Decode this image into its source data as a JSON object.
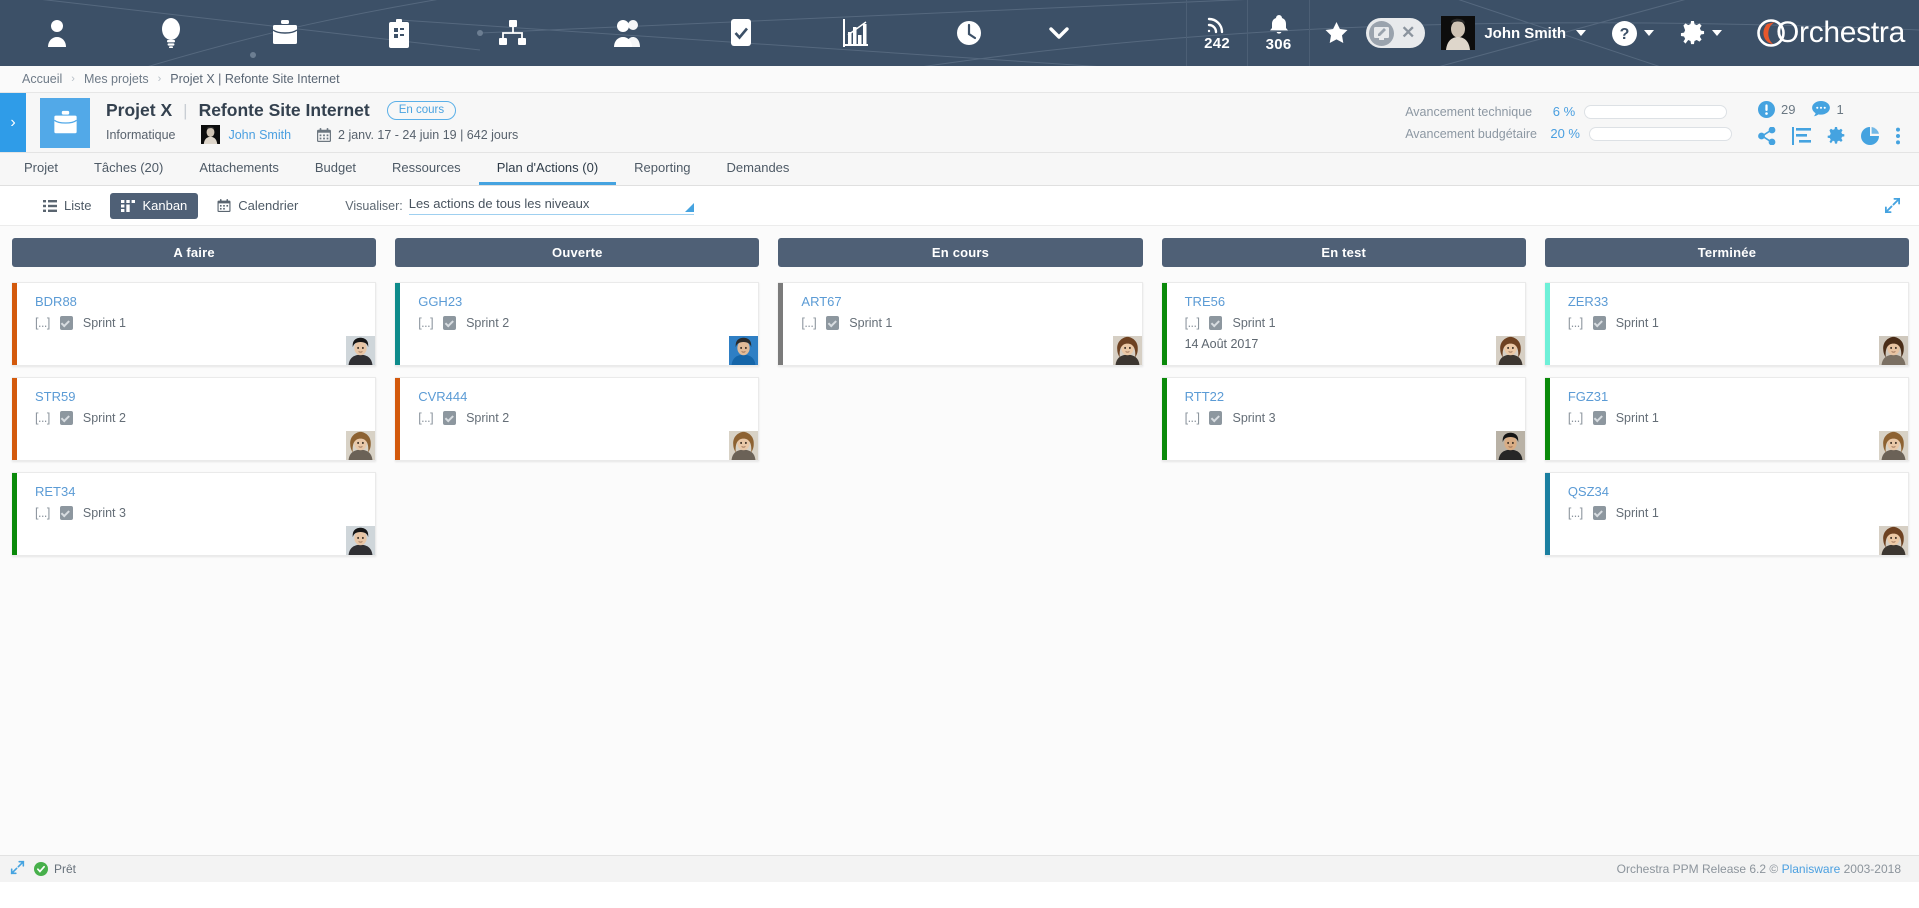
{
  "topnav": {
    "icons": [
      {
        "name": "person-icon",
        "title": "Utilisateur"
      },
      {
        "name": "lightbulb-icon",
        "title": "Idées"
      },
      {
        "name": "briefcase-icon",
        "title": "Portefeuille"
      },
      {
        "name": "clipboard-icon",
        "title": "Projets"
      },
      {
        "name": "org-chart-icon",
        "title": "Organisation"
      },
      {
        "name": "users-icon",
        "title": "Ressources"
      },
      {
        "name": "checkbox-icon",
        "title": "Tâches"
      },
      {
        "name": "bar-chart-icon",
        "title": "Reporting"
      },
      {
        "name": "clock-icon",
        "title": "Temps"
      }
    ],
    "more_label": "chevron-down-icon",
    "feed_count": "242",
    "alert_count": "306",
    "user_name": "John Smith",
    "brand": "Orchestra"
  },
  "breadcrumb": {
    "items": [
      "Accueil",
      "Mes projets",
      "Projet X | Refonte Site Internet"
    ],
    "separator": "›"
  },
  "project": {
    "name": "Projet X",
    "divider": "|",
    "subtitle": "Refonte Site Internet",
    "status": "En cours",
    "category": "Informatique",
    "owner": "John Smith",
    "dates": "2 janv. 17 - 24 juin 19 | 642 jours",
    "progress": [
      {
        "label": "Avancement technique",
        "value": "6 %",
        "percent": 6
      },
      {
        "label": "Avancement budgétaire",
        "value": "20 %",
        "percent": 20
      }
    ],
    "stats": [
      {
        "name": "alert-count",
        "icon": "exclamation-icon",
        "value": "29"
      },
      {
        "name": "comment-count",
        "icon": "comment-icon",
        "value": "1"
      }
    ],
    "actions": [
      "share-icon",
      "outline-icon",
      "gear-icon",
      "pie-chart-icon",
      "more-vertical-icon"
    ]
  },
  "tabs": [
    {
      "label": "Projet",
      "active": false
    },
    {
      "label": "Tâches (20)",
      "active": false
    },
    {
      "label": "Attachements",
      "active": false
    },
    {
      "label": "Budget",
      "active": false
    },
    {
      "label": "Ressources",
      "active": false
    },
    {
      "label": "Plan d'Actions (0)",
      "active": true
    },
    {
      "label": "Reporting",
      "active": false
    },
    {
      "label": "Demandes",
      "active": false
    }
  ],
  "toolbar": {
    "views": [
      {
        "label": "Liste",
        "icon": "list-icon",
        "active": false
      },
      {
        "label": "Kanban",
        "icon": "kanban-icon",
        "active": true
      },
      {
        "label": "Calendrier",
        "icon": "calendar-icon",
        "active": false
      }
    ],
    "visualize_label": "Visualiser:",
    "visualize_value": "Les actions de tous les niveaux",
    "expand_icon": "expand-icon"
  },
  "board": {
    "columns": [
      {
        "title": "A faire",
        "cards": [
          {
            "code": "BDR88",
            "dots": "[...]",
            "sprint": "Sprint 1",
            "date": "",
            "accent": "#d3590c",
            "avatar": "asian-man"
          },
          {
            "code": "STR59",
            "dots": "[...]",
            "sprint": "Sprint 2",
            "date": "",
            "accent": "#d3590c",
            "avatar": "blonde-woman"
          },
          {
            "code": "RET34",
            "dots": "[...]",
            "sprint": "Sprint 3",
            "date": "",
            "accent": "#0a8a0a",
            "avatar": "asian-man"
          }
        ]
      },
      {
        "title": "Ouverte",
        "cards": [
          {
            "code": "GGH23",
            "dots": "[...]",
            "sprint": "Sprint 2",
            "date": "",
            "accent": "#0e8b8b",
            "avatar": "blue-shirt-man"
          },
          {
            "code": "CVR444",
            "dots": "[...]",
            "sprint": "Sprint 2",
            "date": "",
            "accent": "#d3590c",
            "avatar": "blonde-woman"
          }
        ]
      },
      {
        "title": "En cours",
        "cards": [
          {
            "code": "ART67",
            "dots": "[...]",
            "sprint": "Sprint 1",
            "date": "",
            "accent": "#7b7b7b",
            "avatar": "brown-hair-woman"
          }
        ]
      },
      {
        "title": "En test",
        "cards": [
          {
            "code": "TRE56",
            "dots": "[...]",
            "sprint": "Sprint 1",
            "date": "14 Août 2017",
            "accent": "#0a8a0a",
            "avatar": "brown-hair-woman"
          },
          {
            "code": "RTT22",
            "dots": "[...]",
            "sprint": "Sprint 3",
            "date": "",
            "accent": "#0a8a0a",
            "avatar": "dark-hair-man"
          }
        ]
      },
      {
        "title": "Terminée",
        "cards": [
          {
            "code": "ZER33",
            "dots": "[...]",
            "sprint": "Sprint 1",
            "date": "",
            "accent": "#6ef0d8",
            "avatar": "dark-hair-woman"
          },
          {
            "code": "FGZ31",
            "dots": "[...]",
            "sprint": "Sprint 1",
            "date": "",
            "accent": "#0a8a0a",
            "avatar": "blonde-woman"
          },
          {
            "code": "QSZ34",
            "dots": "[...]",
            "sprint": "Sprint 1",
            "date": "",
            "accent": "#1b7fa0",
            "avatar": "brown-hair-woman"
          }
        ]
      }
    ]
  },
  "statusbar": {
    "expand_icon": "expand-arrows-icon",
    "ready": "Prêt",
    "copyright": "Orchestra PPM Release 6.2 © ",
    "vendor": "Planisware",
    "years": " 2003-2018"
  },
  "colors": {
    "navy": "#3c5067",
    "accent_blue": "#45a3e0",
    "column_head": "#4f6076",
    "brand_orange": "#e8572b"
  }
}
